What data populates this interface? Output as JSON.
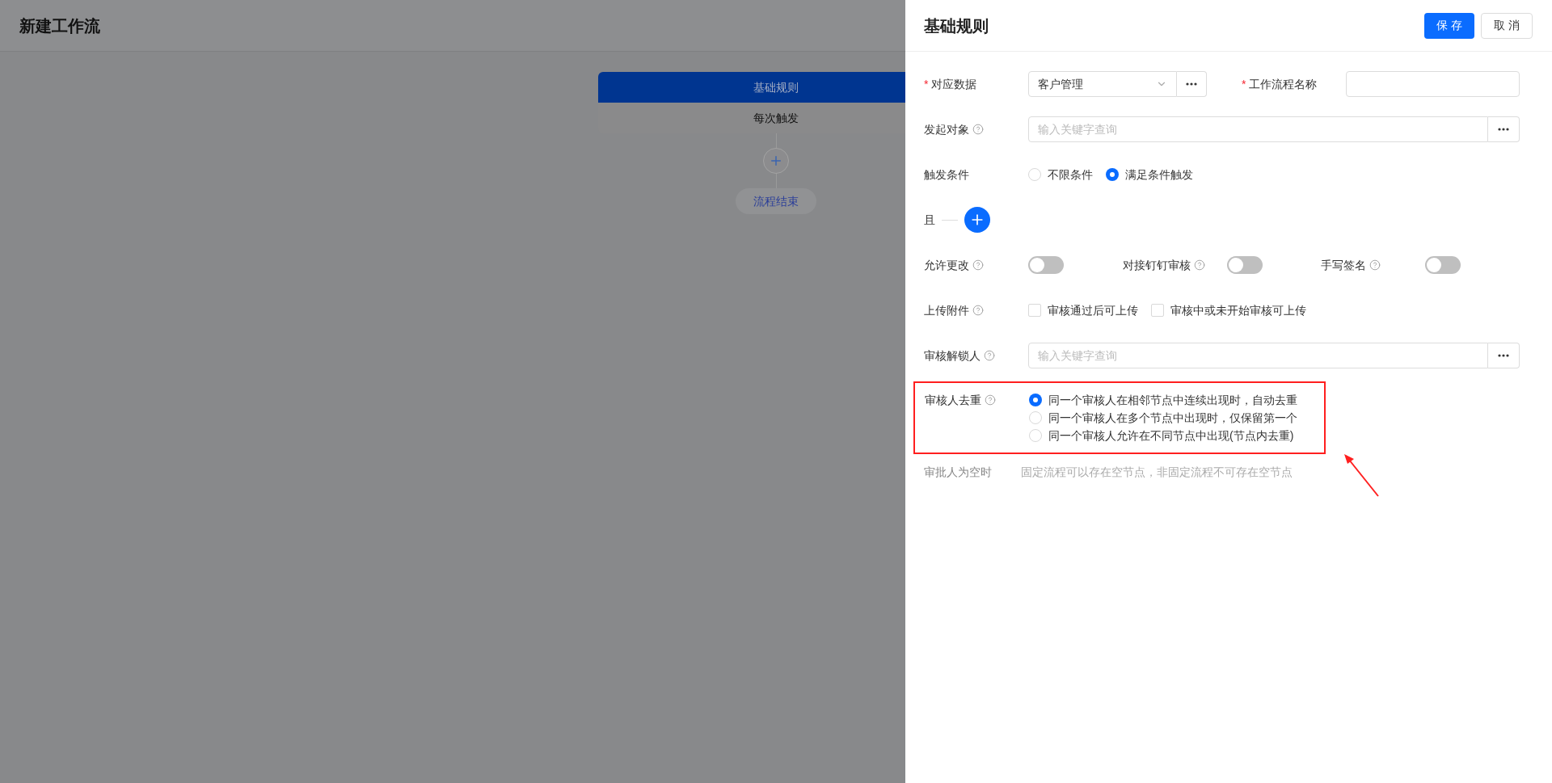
{
  "page": {
    "title": "新建工作流"
  },
  "flow": {
    "nodes": [
      {
        "label": "基础规则",
        "selected": true
      },
      {
        "label": "每次触发",
        "selected": false
      }
    ],
    "end": "流程结束"
  },
  "panel": {
    "title": "基础规则",
    "buttons": [
      {
        "label": "保 存",
        "kind": "primary"
      },
      {
        "label": "取 消",
        "kind": "default"
      }
    ]
  },
  "fields": [
    {
      "kind": "pair",
      "items": [
        {
          "mark": "*",
          "label": "对应数据",
          "kind": "select",
          "value": "客户管理"
        },
        {
          "mark": "*",
          "label": "工作流程名称",
          "kind": "input"
        }
      ]
    },
    {
      "kind": "lookup",
      "label": "发起对象",
      "help": true,
      "placeholder": "输入关键字查询"
    },
    {
      "kind": "radios",
      "label": "触发条件",
      "help": false,
      "options": [
        {
          "label": "不限条件",
          "selected": false
        },
        {
          "label": "满足条件触发",
          "selected": true
        }
      ]
    },
    {
      "kind": "condition",
      "label": "且"
    },
    {
      "kind": "toggles",
      "items": [
        {
          "label": "允许更改",
          "help": true,
          "on": false
        },
        {
          "label": "对接钉钉审核",
          "help": true,
          "on": false
        },
        {
          "label": "手写签名",
          "help": true,
          "on": false
        }
      ]
    },
    {
      "kind": "checks",
      "label": "上传附件",
      "help": true,
      "options": [
        {
          "label": "审核通过后可上传",
          "checked": false
        },
        {
          "label": "审核中或未开始审核可上传",
          "checked": false
        }
      ]
    },
    {
      "kind": "lookup",
      "label": "审核解锁人",
      "help": true,
      "placeholder": "输入关键字查询"
    },
    {
      "kind": "radio_list",
      "label": "审核人去重",
      "help": true,
      "highlighted": true,
      "options": [
        {
          "label": "同一个审核人在相邻节点中连续出现时，自动去重",
          "selected": true
        },
        {
          "label": "同一个审核人在多个节点中出现时，仅保留第一个",
          "selected": false
        },
        {
          "label": "同一个审核人允许在不同节点中出现(节点内去重)",
          "selected": false
        }
      ]
    },
    {
      "kind": "note",
      "label": "审批人为空时",
      "text": "固定流程可以存在空节点，非固定流程不可存在空节点"
    }
  ]
}
